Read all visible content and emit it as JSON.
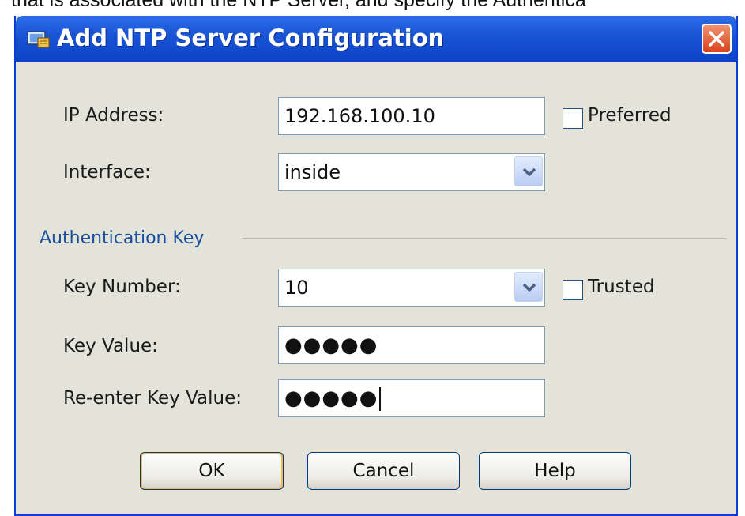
{
  "background_text": "that is associated with the NTP Server, and specify the Authentica",
  "stray_mark": "-",
  "dialog": {
    "title": "Add NTP Server Configuration",
    "title_icon": "network-config-icon",
    "close_icon": "close-icon"
  },
  "fields": {
    "ip_address_label": "IP Address:",
    "ip_address_value": "192.168.100.10",
    "preferred_label": "Preferred",
    "preferred_checked": false,
    "interface_label": "Interface:",
    "interface_value": "inside"
  },
  "authentication": {
    "group_label": "Authentication Key",
    "key_number_label": "Key Number:",
    "key_number_value": "10",
    "trusted_label": "Trusted",
    "trusted_checked": false,
    "key_value_label": "Key Value:",
    "key_value_masked": "●●●●●",
    "reenter_label": "Re-enter Key Value:",
    "reenter_masked": "●●●●●"
  },
  "buttons": {
    "ok": "OK",
    "cancel": "Cancel",
    "help": "Help"
  },
  "colors": {
    "titlebar": "#0c43c8",
    "close_button": "#d9441e",
    "group_label": "#1a4f9e",
    "dialog_background": "#e4e3da",
    "default_button_highlight": "#f7b84a"
  }
}
